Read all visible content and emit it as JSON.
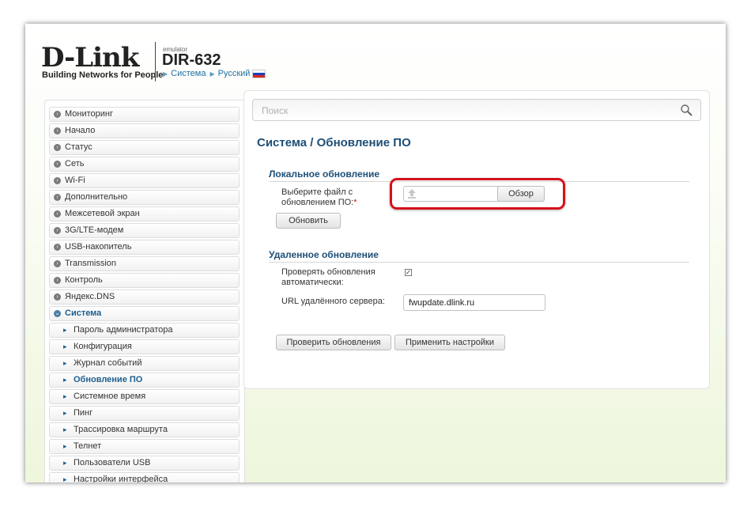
{
  "header": {
    "logo": "D-Link",
    "tagline": "Building Networks for People",
    "emulator": "emulator",
    "model": "DIR-632",
    "breadcrumb": [
      "Система",
      "Русский"
    ]
  },
  "sidebar": {
    "items": [
      {
        "label": "Мониторинг"
      },
      {
        "label": "Начало"
      },
      {
        "label": "Статус"
      },
      {
        "label": "Сеть"
      },
      {
        "label": "Wi-Fi"
      },
      {
        "label": "Дополнительно"
      },
      {
        "label": "Межсетевой экран"
      },
      {
        "label": "3G/LTE-модем"
      },
      {
        "label": "USB-накопитель"
      },
      {
        "label": "Transmission"
      },
      {
        "label": "Контроль"
      },
      {
        "label": "Яндекс.DNS"
      },
      {
        "label": "Система"
      }
    ],
    "subitems": [
      {
        "label": "Пароль администратора"
      },
      {
        "label": "Конфигурация"
      },
      {
        "label": "Журнал событий"
      },
      {
        "label": "Обновление ПО"
      },
      {
        "label": "Системное время"
      },
      {
        "label": "Пинг"
      },
      {
        "label": "Трассировка маршрута"
      },
      {
        "label": "Телнет"
      },
      {
        "label": "Пользователи USB"
      },
      {
        "label": "Настройки интерфейса"
      }
    ]
  },
  "main": {
    "search_placeholder": "Поиск",
    "title_section": "Система /",
    "title_page": "Обновление ПО",
    "local": {
      "heading": "Локальное обновление",
      "file_label_1": "Выберите файл с",
      "file_label_2": "обновлением ПО:",
      "required_mark": "*",
      "browse_label": "Обзор",
      "update_button": "Обновить"
    },
    "remote": {
      "heading": "Удаленное обновление",
      "auto_check_label_1": "Проверять обновления",
      "auto_check_label_2": "автоматически:",
      "auto_check_checked": true,
      "server_url_label": "URL удалённого сервера:",
      "server_url_value": "fwupdate.dlink.ru",
      "check_button": "Проверить обновления",
      "apply_button": "Применить настройки"
    }
  },
  "colors": {
    "accent": "#1d4f77",
    "highlight": "#d4111b"
  }
}
